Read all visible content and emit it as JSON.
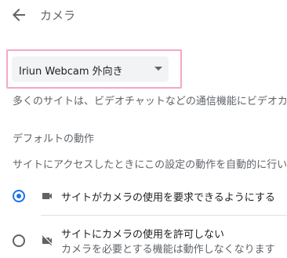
{
  "header": {
    "title": "カメラ"
  },
  "camera_select": {
    "selected": "Iriun Webcam 外向き"
  },
  "description": "多くのサイトは、ビデオチャットなどの通信機能にビデオカ",
  "default_behavior": {
    "heading": "デフォルトの動作",
    "description": "サイトにアクセスしたときにこの設定の動作を自動的に行い",
    "options": [
      {
        "label": "サイトがカメラの使用を要求できるようにする",
        "sublabel": "",
        "selected": true,
        "icon": "videocam-icon"
      },
      {
        "label": "サイトにカメラの使用を許可しない",
        "sublabel": "カメラを必要とする機能は動作しなくなります",
        "selected": false,
        "icon": "videocam-off-icon"
      }
    ]
  },
  "colors": {
    "accent": "#1a73e8",
    "highlight_border": "#f4a7c7",
    "select_bg": "#f1f3f4"
  }
}
